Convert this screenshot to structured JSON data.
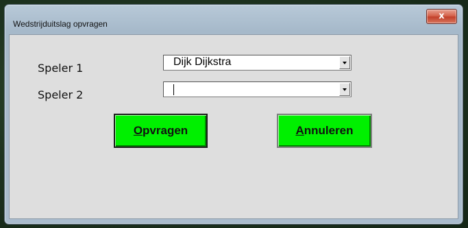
{
  "window": {
    "title": "Wedstrijduitslag opvragen",
    "close_glyph": "x"
  },
  "form": {
    "speler1": {
      "label": "Speler 1",
      "value": "Dijk Dijkstra"
    },
    "speler2": {
      "label": "Speler 2",
      "value": ""
    }
  },
  "buttons": {
    "opvragen": {
      "mnemonic": "O",
      "rest": "pvragen"
    },
    "annuleren": {
      "mnemonic": "A",
      "rest": "nnuleren"
    }
  },
  "colors": {
    "button_green": "#00f000",
    "client_bg": "#dedede",
    "close_red": "#c2412b"
  },
  "icons": {
    "close": "close-icon",
    "dropdown": "chevron-down-icon"
  }
}
